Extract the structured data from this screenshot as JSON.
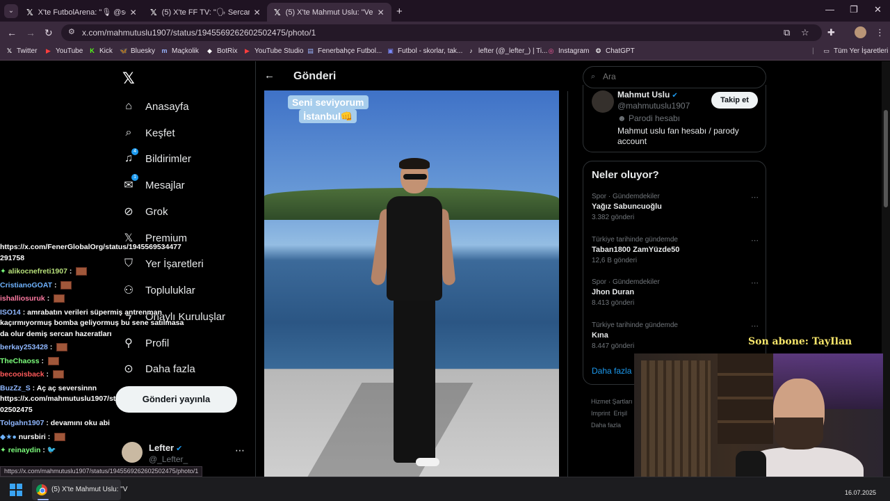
{
  "browser": {
    "tabs": [
      {
        "title": "X'te FutbolArena: \"🎙 @sercan",
        "active": false
      },
      {
        "title": "(5) X'te FF TV: \"🗣 Sercan Hamza",
        "active": false
      },
      {
        "title": "(5) X'te Mahmut Uslu: \"Verdiği sö",
        "active": true
      }
    ],
    "url": "x.com/mahmutuslu1907/status/1945569262602502475/photo/1",
    "bookmarks": [
      {
        "label": "Twitter",
        "icon": "x-logo-icon"
      },
      {
        "label": "YouTube",
        "icon": "youtube-icon"
      },
      {
        "label": "Kick",
        "icon": "kick-icon"
      },
      {
        "label": "Bluesky",
        "icon": "bluesky-icon"
      },
      {
        "label": "Maçkolik",
        "icon": "mackolik-icon"
      },
      {
        "label": "BotRix",
        "icon": "botrix-icon"
      },
      {
        "label": "YouTube Studio",
        "icon": "youtube-icon"
      },
      {
        "label": "Fenerbahçe Futbol...",
        "icon": "fenerbahce-icon"
      },
      {
        "label": "Futbol - skorlar, tak...",
        "icon": "futbol-icon"
      },
      {
        "label": "lefter (@_lefter_) | Ti...",
        "icon": "tiktok-icon"
      },
      {
        "label": "Instagram",
        "icon": "instagram-icon"
      },
      {
        "label": "ChatGPT",
        "icon": "chatgpt-icon"
      }
    ],
    "all_bookmarks": "Tüm Yer İşaretleri",
    "status_url": "https://x.com/mahmutuslu1907/status/1945569262602502475/photo/1"
  },
  "nav": {
    "items": [
      {
        "label": "Anasayfa",
        "icon": "home-icon",
        "badge": ""
      },
      {
        "label": "Keşfet",
        "icon": "search-icon",
        "badge": ""
      },
      {
        "label": "Bildirimler",
        "icon": "bell-icon",
        "badge": "4"
      },
      {
        "label": "Mesajlar",
        "icon": "mail-icon",
        "badge": "1"
      },
      {
        "label": "Grok",
        "icon": "grok-icon",
        "badge": ""
      },
      {
        "label": "Premium",
        "icon": "x-logo-icon",
        "badge": ""
      },
      {
        "label": "Yer İşaretleri",
        "icon": "bookmark-icon",
        "badge": ""
      },
      {
        "label": "Topluluklar",
        "icon": "communities-icon",
        "badge": ""
      },
      {
        "label": "Onaylı Kuruluşlar",
        "icon": "lightning-icon",
        "badge": ""
      },
      {
        "label": "Profil",
        "icon": "person-icon",
        "badge": ""
      },
      {
        "label": "Daha fazla",
        "icon": "more-circle-icon",
        "badge": ""
      }
    ],
    "post_button": "Gönderi yayınla",
    "account": {
      "name": "Lefter",
      "handle": "@_Lefter_"
    }
  },
  "chat": [
    {
      "user": "",
      "text": "https://x.com/FenerGlobalOrg/status/1945569534477"
    },
    {
      "user": "",
      "text": "291758"
    },
    {
      "user": "alikocnefreti1907",
      "text": "",
      "emote": true,
      "user_color": "#b7e07a"
    },
    {
      "user": "CristianoGOAT",
      "text": "",
      "emote": true,
      "user_color": "#6fb3ff"
    },
    {
      "user": "ishalliosuruk",
      "text": "",
      "emote": true,
      "user_color": "#ff7aa2"
    },
    {
      "user": "ISO14",
      "text": "amrabatın verileri süpermiş antrenman",
      "user_color": "#8fb7ff"
    },
    {
      "user": "",
      "text": "kaçırmıyormuş bomba geliyormuş bu sene satılmasa"
    },
    {
      "user": "",
      "text": "da olur demiş sercan hazeratları"
    },
    {
      "user": "berkay253428",
      "text": "",
      "emote": true,
      "user_color": "#8fb7ff"
    },
    {
      "user": "TheChaoss",
      "text": "",
      "emote": true,
      "user_color": "#7cff7c"
    },
    {
      "user": "becooisback",
      "text": "",
      "emote": true,
      "user_color": "#ff5a5a"
    },
    {
      "user": "BuzZz_S",
      "text": "Aç aç seversinnn",
      "user_color": "#8fb7ff"
    },
    {
      "user": "",
      "text": "https://x.com/mahmutuslu1907/status/19455692626"
    },
    {
      "user": "",
      "text": "02502475"
    },
    {
      "user": "Tolgahn1907",
      "text": "devamını oku abi",
      "user_color": "#8fb7ff"
    },
    {
      "user": "nursbiri",
      "text": "",
      "emote": true,
      "user_color": "#ffffff"
    },
    {
      "user": "reinaydin",
      "text": "",
      "emote": true,
      "user_color": "#7cff7c"
    }
  ],
  "post": {
    "header": "Gönderi",
    "photo_caption_line1": "Seni seviyorum",
    "photo_caption_line2": "İstanbul👊"
  },
  "sidebar": {
    "search_placeholder": "Ara",
    "profile": {
      "name": "Mahmut Uslu",
      "handle": "@mahmutuslu1907",
      "parody": "Parodi hesabı",
      "bio": "Mahmut uslu fan hesabı / parody account",
      "follow": "Takip et"
    },
    "trends_title": "Neler oluyor?",
    "trends": [
      {
        "context": "Spor · Gündemdekiler",
        "name": "Yağız Sabuncuoğlu",
        "posts": "3.382 gönderi"
      },
      {
        "context": "Türkiye tarihinde gündemde",
        "name": "Taban1800 ZamYüzde50",
        "posts": "12,6 B gönderi"
      },
      {
        "context": "Spor · Gündemdekiler",
        "name": "Jhon Duran",
        "posts": "8.413 gönderi"
      },
      {
        "context": "Türkiye tarihinde gündemde",
        "name": "Kına",
        "posts": "8.447 gönderi"
      }
    ],
    "show_more": "Daha fazla göster",
    "footer": [
      "Hizmet Şartları",
      "Imprint",
      "Erişil",
      "Daha fazla"
    ]
  },
  "stream": {
    "last_subscriber": "Son abone: TayIlan"
  },
  "taskbar": {
    "chrome_title": "(5) X'te Mahmut Uslu: \"V",
    "date": "16.07.2025"
  }
}
